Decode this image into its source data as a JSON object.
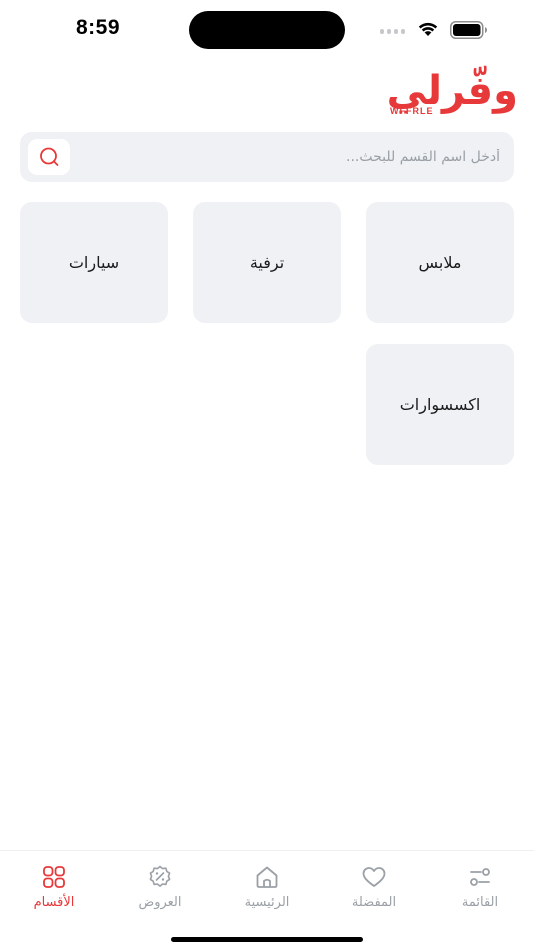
{
  "status_bar": {
    "time": "8:59",
    "icons": [
      "signal-icon",
      "wifi-icon",
      "battery-icon"
    ]
  },
  "logo": {
    "text": "وفّرلي",
    "subtext": "WFFRLE"
  },
  "search": {
    "placeholder": "أدخل اسم القسم للبحث...",
    "value": "",
    "icon": "search-icon"
  },
  "categories": [
    {
      "label": "ملابس"
    },
    {
      "label": "ترفية"
    },
    {
      "label": "سيارات"
    },
    {
      "label": "اكسسوارات"
    }
  ],
  "tab_bar": {
    "tabs": [
      {
        "label": "القائمة",
        "icon": "sliders-icon",
        "active": false
      },
      {
        "label": "المفضلة",
        "icon": "heart-icon",
        "active": false
      },
      {
        "label": "الرئيسية",
        "icon": "home-icon",
        "active": false
      },
      {
        "label": "العروض",
        "icon": "discount-icon",
        "active": false
      },
      {
        "label": "الأقسام",
        "icon": "grid-icon",
        "active": true
      }
    ]
  },
  "colors": {
    "accent": "#e8393a",
    "card_bg": "#eff1f4",
    "inactive": "#9aa0a6"
  }
}
